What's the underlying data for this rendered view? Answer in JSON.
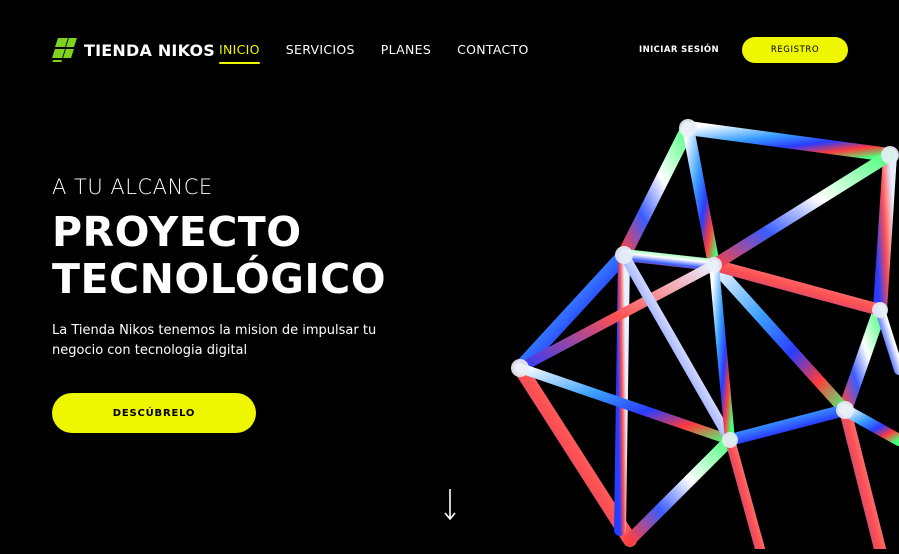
{
  "nav": {
    "brand": "TIENDA NIKOS",
    "items": [
      {
        "label": "INICIO",
        "active": true
      },
      {
        "label": "SERVICIOS",
        "active": false
      },
      {
        "label": "PLANES",
        "active": false
      },
      {
        "label": "CONTACTO",
        "active": false
      }
    ],
    "login_label": "INICIAR SESIÓN",
    "register_label": "REGISTRO"
  },
  "hero": {
    "eyebrow": "A TU ALCANCE",
    "title_line1": "PROYECTO",
    "title_line2": "TECNOLÓGICO",
    "description": "La Tienda Nikos tenemos la mision de impulsar tu negocio con tecnologia digital",
    "cta_label": "DESCÚBRELO"
  },
  "icons": {
    "logo": "logo-blocks-icon",
    "scroll": "arrow-down-icon"
  },
  "colors": {
    "accent": "#eef600",
    "logo_green": "#7ed321",
    "background": "#000000"
  }
}
